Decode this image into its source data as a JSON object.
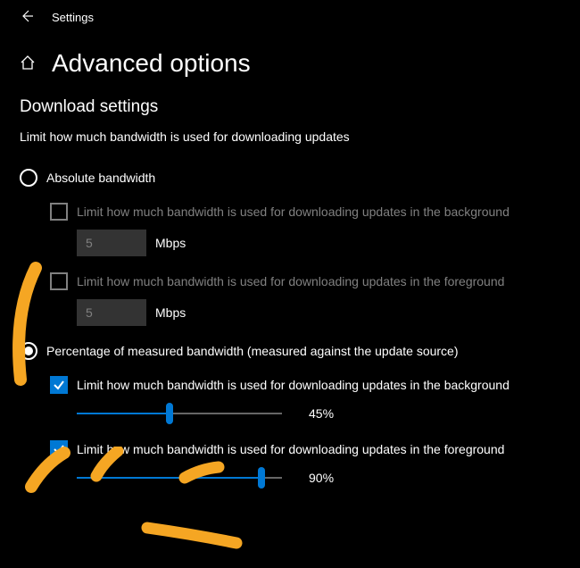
{
  "titlebar": {
    "app": "Settings"
  },
  "header": {
    "title": "Advanced options"
  },
  "section": {
    "title": "Download settings",
    "subtitle": "Limit how much bandwidth is used for downloading updates"
  },
  "absolute": {
    "label": "Absolute bandwidth",
    "bg": {
      "label": "Limit how much bandwidth is used for downloading updates in the background",
      "value": "5",
      "unit": "Mbps"
    },
    "fg": {
      "label": "Limit how much bandwidth is used for downloading updates in the foreground",
      "value": "5",
      "unit": "Mbps"
    }
  },
  "percentage": {
    "label": "Percentage of measured bandwidth (measured against the update source)",
    "bg": {
      "label": "Limit how much bandwidth is used for downloading updates in the background",
      "value": "45%",
      "pct": 45
    },
    "fg": {
      "label": "Limit how much bandwidth is used for downloading updates in the foreground",
      "value": "90%",
      "pct": 90
    }
  }
}
